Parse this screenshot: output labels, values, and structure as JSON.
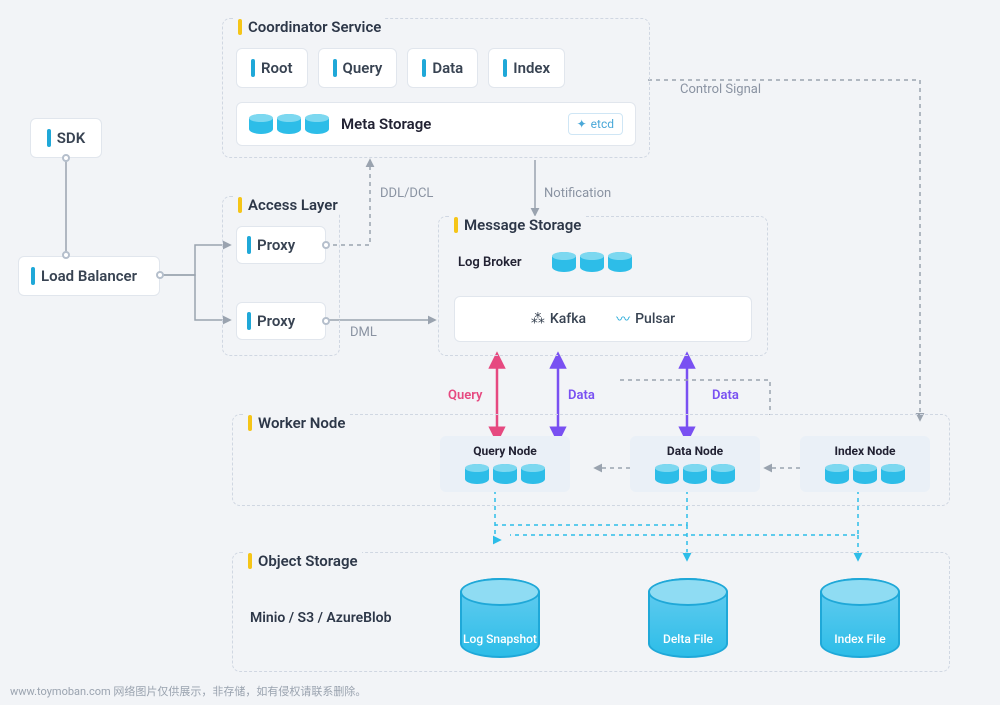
{
  "sdk": {
    "label": "SDK"
  },
  "loadBalancer": {
    "label": "Load Balancer"
  },
  "accessLayer": {
    "title": "Access Layer",
    "proxy1": "Proxy",
    "proxy2": "Proxy"
  },
  "coordinator": {
    "title": "Coordinator Service",
    "root": "Root",
    "query": "Query",
    "data": "Data",
    "index": "Index",
    "metaStorage": "Meta Storage",
    "etcd": "etcd"
  },
  "connLabels": {
    "ddl": "DDL/DCL",
    "notification": "Notification",
    "dml": "DML",
    "controlSignal": "Control Signal",
    "query": "Query",
    "data1": "Data",
    "data2": "Data"
  },
  "messageStorage": {
    "title": "Message Storage",
    "logBroker": "Log Broker",
    "kafka": "Kafka",
    "pulsar": "Pulsar"
  },
  "workerNode": {
    "title": "Worker Node",
    "queryNode": "Query Node",
    "dataNode": "Data Node",
    "indexNode": "Index Node"
  },
  "objectStorage": {
    "title": "Object Storage",
    "providers": "Minio / S3 / AzureBlob",
    "logSnapshot": "Log Snapshot",
    "deltaFile": "Delta File",
    "indexFile": "Index File"
  },
  "footer": "www.toymoban.com 网络图片仅供展示，非存储，如有侵权请联系删除。"
}
